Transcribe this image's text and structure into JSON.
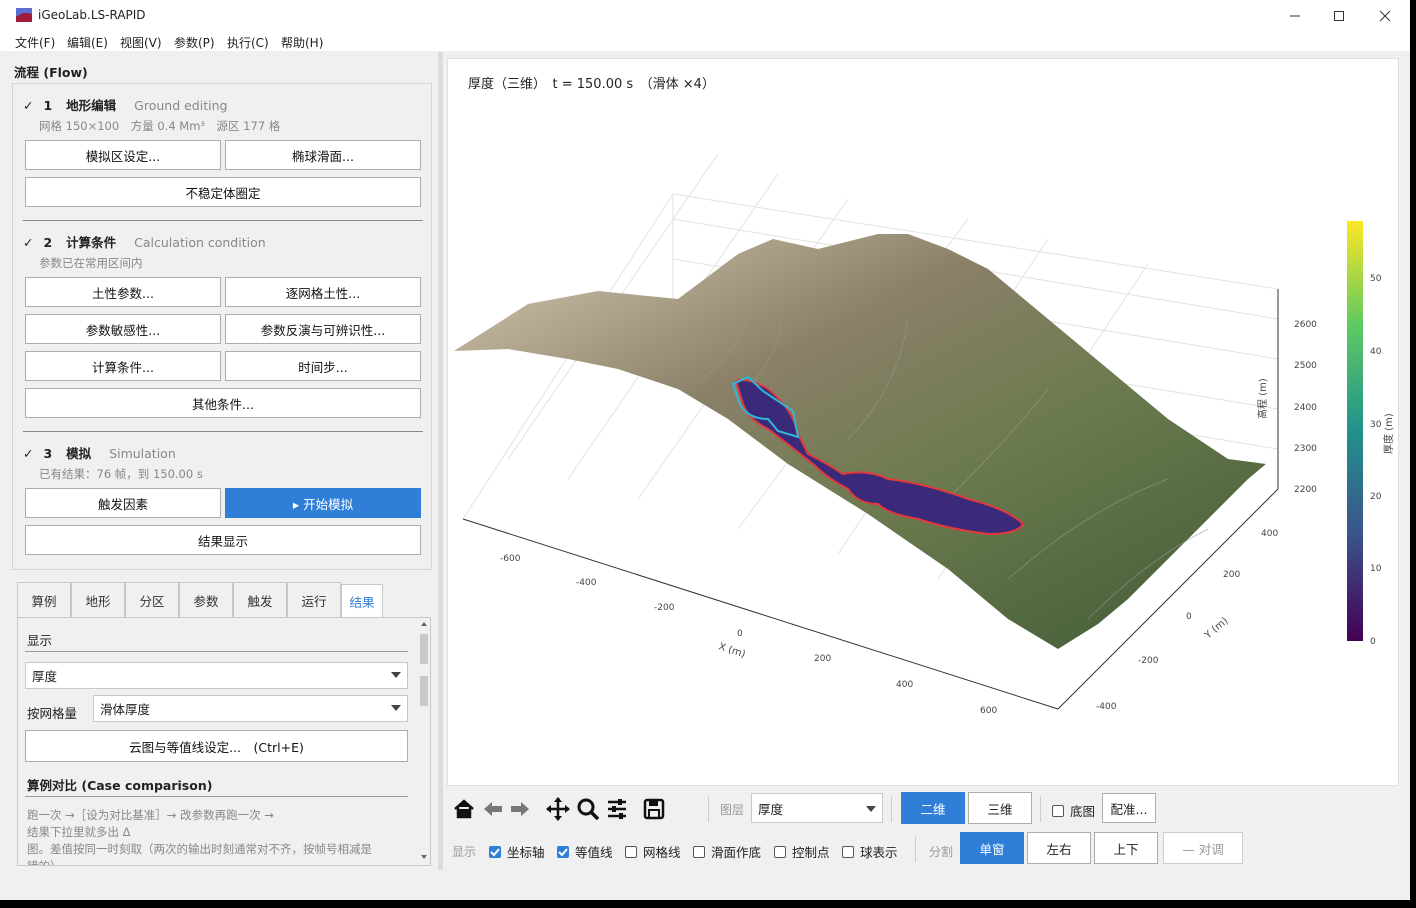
{
  "window": {
    "title": "iGeoLab.LS-RAPID"
  },
  "menu": [
    "文件(F)",
    "编辑(E)",
    "视图(V)",
    "参数(P)",
    "执行(C)",
    "帮助(H)"
  ],
  "flow": {
    "title": "流程 (Flow)",
    "s1": {
      "check": "✓",
      "num": "1",
      "zh": "地形编辑",
      "en": "Ground editing",
      "sub": "网格 150×100　方量 0.4 Mm³　源区 177 格",
      "buttons": [
        "模拟区设定...",
        "椭球滑面...",
        "不稳定体圈定"
      ]
    },
    "s2": {
      "check": "✓",
      "num": "2",
      "zh": "计算条件",
      "en": "Calculation condition",
      "sub": "参数已在常用区间内",
      "buttons": [
        "土性参数...",
        "逐网格土性...",
        "参数敏感性...",
        "参数反演与可辨识性...",
        "计算条件...",
        "时间步...",
        "其他条件..."
      ]
    },
    "s3": {
      "check": "✓",
      "num": "3",
      "zh": "模拟",
      "en": "Simulation",
      "sub": "已有结果：76 帧，到 150.00 s",
      "buttons": [
        "触发因素",
        "▸ 开始模拟",
        "结果显示"
      ]
    }
  },
  "tabs": [
    "算例",
    "地形",
    "分区",
    "参数",
    "触发",
    "运行",
    "结果"
  ],
  "results": {
    "display_header": "显示",
    "quantity": "厚度",
    "per_grid_label": "按网格量",
    "per_grid_value": "滑体厚度",
    "contour_button": "云图与等值线设定...　(Ctrl+E)",
    "case_header": "算例对比 (Case comparison)",
    "case_text_1": "跑一次 →［设为对比基准］→ 改参数再跑一次 →",
    "case_text_2": "结果下拉里就多出 Δ",
    "case_text_3": "图。差值按同一时刻取（两次的输出时刻通常对不齐，按帧号相减是",
    "case_text_4": "错的）"
  },
  "plot": {
    "title": "厚度（三维）　t = 150.00 s　（滑体 ×4）",
    "x_label": "X (m)",
    "y_label": "Y (m)",
    "z_label": "高程 (m)",
    "x_ticks": [
      "-600",
      "-400",
      "-200",
      "0",
      "200",
      "400",
      "600"
    ],
    "y_ticks": [
      "400",
      "200",
      "0",
      "-200",
      "-400"
    ],
    "z_ticks": [
      "2600",
      "2500",
      "2400",
      "2300",
      "2200"
    ],
    "colorbar_label": "厚度 (m)",
    "colorbar_ticks": [
      "50",
      "40",
      "30",
      "20",
      "10",
      "0"
    ],
    "colorbar_colors": [
      "#fde725",
      "#5ec962",
      "#21918c",
      "#3b528b",
      "#440154"
    ]
  },
  "toolbar": {
    "icons": [
      "home-icon",
      "back-icon",
      "forward-icon",
      "pan-icon",
      "zoom-icon",
      "configure-icon",
      "save-icon"
    ],
    "layer_label": "图层",
    "layer_value": "厚度",
    "view_2d": "二维",
    "view_3d": "三维",
    "basemap": "底图",
    "register": "配准...",
    "display_label": "显示",
    "checks": [
      {
        "label": "坐标轴",
        "on": true
      },
      {
        "label": "等值线",
        "on": true
      },
      {
        "label": "网格线",
        "on": false
      },
      {
        "label": "滑面作底",
        "on": false
      },
      {
        "label": "控制点",
        "on": false
      },
      {
        "label": "球表示",
        "on": false
      }
    ],
    "split_label": "分割",
    "split": [
      "单窗",
      "左右",
      "上下"
    ],
    "sync": "— 对调"
  }
}
